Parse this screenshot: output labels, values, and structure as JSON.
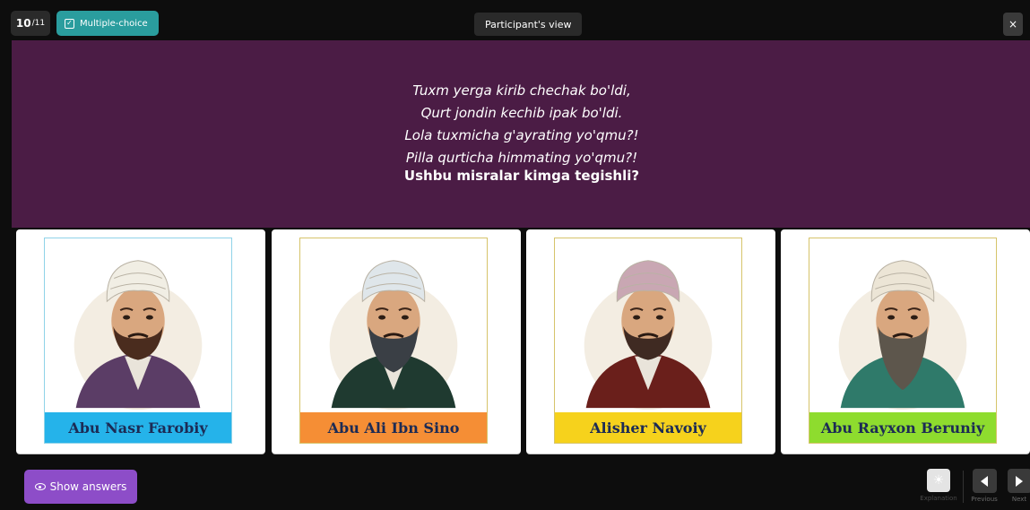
{
  "header": {
    "counter": "10",
    "counter_suffix": "/11",
    "question_type": "Multiple-choice",
    "view_label": "Participant's view",
    "close_label": "×"
  },
  "question": {
    "lines": [
      "Tuxm yerga kirib chechak bo'ldi,",
      "Qurt jondin kechib ipak bo'ldi.",
      "Lola tuxmicha g'ayrating yo'qmu?!",
      "Pilla qurticha himmating yo'qmu?!"
    ],
    "prompt": "Ushbu misralar kimga tegishli?"
  },
  "options": [
    {
      "name": "Abu Nasr Farobiy",
      "band_color": "#25b3ea",
      "turban_color": "#f1eee4",
      "robe_color": "#5b3d66",
      "beard_color": "#4a2c1e",
      "beard": "short"
    },
    {
      "name": "Abu Ali Ibn Sino",
      "band_color": "#f58e35",
      "turban_color": "#dfe6ea",
      "robe_color": "#1f3a30",
      "beard_color": "#3a3f45",
      "beard": "medium"
    },
    {
      "name": "Alisher Navoiy",
      "band_color": "#f6d21c",
      "turban_color": "#c9a7b3",
      "robe_color": "#6a1f1b",
      "beard_color": "#3f2a22",
      "beard": "short"
    },
    {
      "name": "Abu Rayxon Beruniy",
      "band_color": "#8edc2e",
      "turban_color": "#ece5d6",
      "robe_color": "#2f7a6a",
      "beard_color": "#5d564c",
      "beard": "long"
    }
  ],
  "footer": {
    "show_answers_label": "Show answers",
    "explanation_label": "Explanation",
    "previous_label": "Previous",
    "next_label": "Next"
  }
}
